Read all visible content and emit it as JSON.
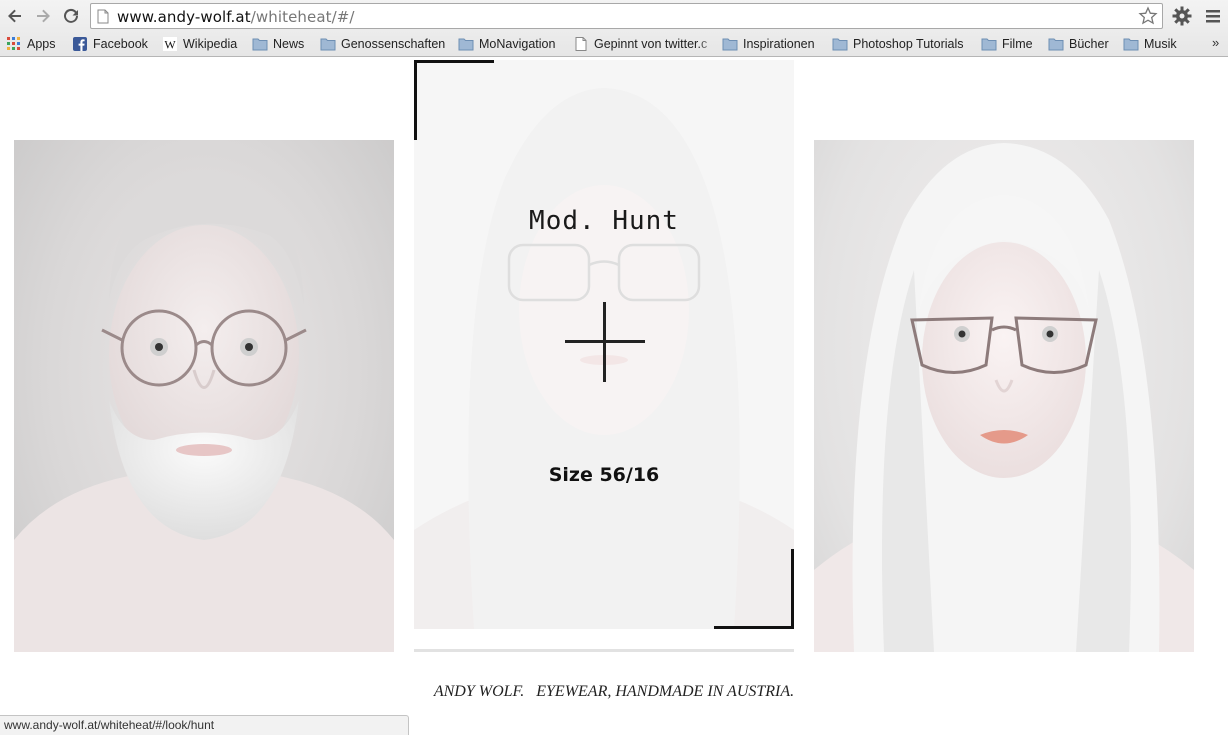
{
  "browser": {
    "url_host": "www.andy-wolf.at",
    "url_path": "/whiteheat/#/",
    "bookmarks": [
      {
        "label": "Apps",
        "icon": "apps-grid-icon"
      },
      {
        "label": "Facebook",
        "icon": "facebook-icon"
      },
      {
        "label": "Wikipedia",
        "icon": "wikipedia-icon"
      },
      {
        "label": "News",
        "icon": "folder-icon"
      },
      {
        "label": "Genossenschaften",
        "icon": "folder-icon"
      },
      {
        "label": "MoNavigation",
        "icon": "folder-icon"
      },
      {
        "label": "Gepinnt von twitter.c",
        "icon": "page-icon"
      },
      {
        "label": "Inspirationen",
        "icon": "folder-icon"
      },
      {
        "label": "Photoshop Tutorials",
        "icon": "folder-icon"
      },
      {
        "label": "Filme",
        "icon": "folder-icon"
      },
      {
        "label": "Bücher",
        "icon": "folder-icon"
      },
      {
        "label": "Musik",
        "icon": "folder-icon"
      }
    ],
    "more_label": "»",
    "status_url": "www.andy-wolf.at/whiteheat/#/look/hunt"
  },
  "look": {
    "model_name": "Mod. Hunt",
    "size": "Size 56/16"
  },
  "footer": {
    "brand": "ANDY WOLF.",
    "tagline": "EYEWEAR, HANDMADE IN AUSTRIA."
  },
  "colors": {
    "accent": "#111111",
    "folder": "#7d9ec0"
  }
}
